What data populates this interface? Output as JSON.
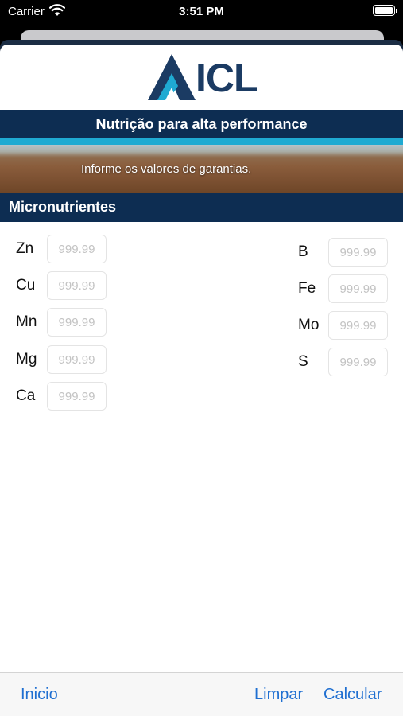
{
  "status_bar": {
    "carrier": "Carrier",
    "time": "3:51 PM",
    "icons": [
      "wifi-icon",
      "battery-icon"
    ]
  },
  "header": {
    "logo_text": "ICL",
    "banner_title": "Nutrição para alta performance",
    "banner_hint": "Informe os valores de garantias."
  },
  "section": {
    "title": "Micronutrientes"
  },
  "left_fields": [
    {
      "label": "Zn",
      "placeholder": "999.99"
    },
    {
      "label": "Cu",
      "placeholder": "999.99"
    },
    {
      "label": "Mn",
      "placeholder": "999.99"
    },
    {
      "label": "Mg",
      "placeholder": "999.99"
    },
    {
      "label": "Ca",
      "placeholder": "999.99"
    }
  ],
  "right_fields": [
    {
      "label": "B",
      "placeholder": "999.99"
    },
    {
      "label": "Fe",
      "placeholder": "999.99"
    },
    {
      "label": "Mo",
      "placeholder": "999.99"
    },
    {
      "label": "S",
      "placeholder": "999.99"
    }
  ],
  "toolbar": {
    "home_label": "Inicio",
    "clear_label": "Limpar",
    "calculate_label": "Calcular"
  },
  "colors": {
    "brand_navy": "#0d2d52",
    "accent_cyan": "#1faad2",
    "link_blue": "#1f6fd1",
    "logo_blue": "#1b3b63"
  }
}
